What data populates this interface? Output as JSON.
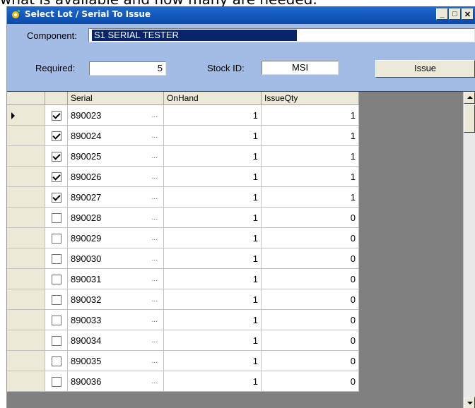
{
  "document_text": "what is available and how many are needed.",
  "window": {
    "title": "Select Lot / Serial To Issue",
    "buttons": [
      "_",
      "□",
      "✕"
    ]
  },
  "form": {
    "component_label": "Component:",
    "component_value": "S1 SERIAL TESTER",
    "required_label": "Required:",
    "required_value": "5",
    "stock_id_label": "Stock ID:",
    "stock_id_value": "MSI",
    "issue_button": "Issue"
  },
  "grid": {
    "columns": [
      "Serial",
      "OnHand",
      "IssueQty"
    ],
    "ellipsis": "...",
    "rows": [
      {
        "checked": true,
        "serial": "890023",
        "onhand": "1",
        "issueqty": "1",
        "current": true
      },
      {
        "checked": true,
        "serial": "890024",
        "onhand": "1",
        "issueqty": "1"
      },
      {
        "checked": true,
        "serial": "890025",
        "onhand": "1",
        "issueqty": "1"
      },
      {
        "checked": true,
        "serial": "890026",
        "onhand": "1",
        "issueqty": "1"
      },
      {
        "checked": true,
        "serial": "890027",
        "onhand": "1",
        "issueqty": "1"
      },
      {
        "checked": false,
        "serial": "890028",
        "onhand": "1",
        "issueqty": "0"
      },
      {
        "checked": false,
        "serial": "890029",
        "onhand": "1",
        "issueqty": "0"
      },
      {
        "checked": false,
        "serial": "890030",
        "onhand": "1",
        "issueqty": "0"
      },
      {
        "checked": false,
        "serial": "890031",
        "onhand": "1",
        "issueqty": "0"
      },
      {
        "checked": false,
        "serial": "890032",
        "onhand": "1",
        "issueqty": "0"
      },
      {
        "checked": false,
        "serial": "890033",
        "onhand": "1",
        "issueqty": "0"
      },
      {
        "checked": false,
        "serial": "890034",
        "onhand": "1",
        "issueqty": "0"
      },
      {
        "checked": false,
        "serial": "890035",
        "onhand": "1",
        "issueqty": "0"
      },
      {
        "checked": false,
        "serial": "890036",
        "onhand": "1",
        "issueqty": "0"
      }
    ]
  },
  "colors": {
    "titlebar": "#0a49a8",
    "form_background": "#a3bce6",
    "selection": "#0a246a"
  }
}
